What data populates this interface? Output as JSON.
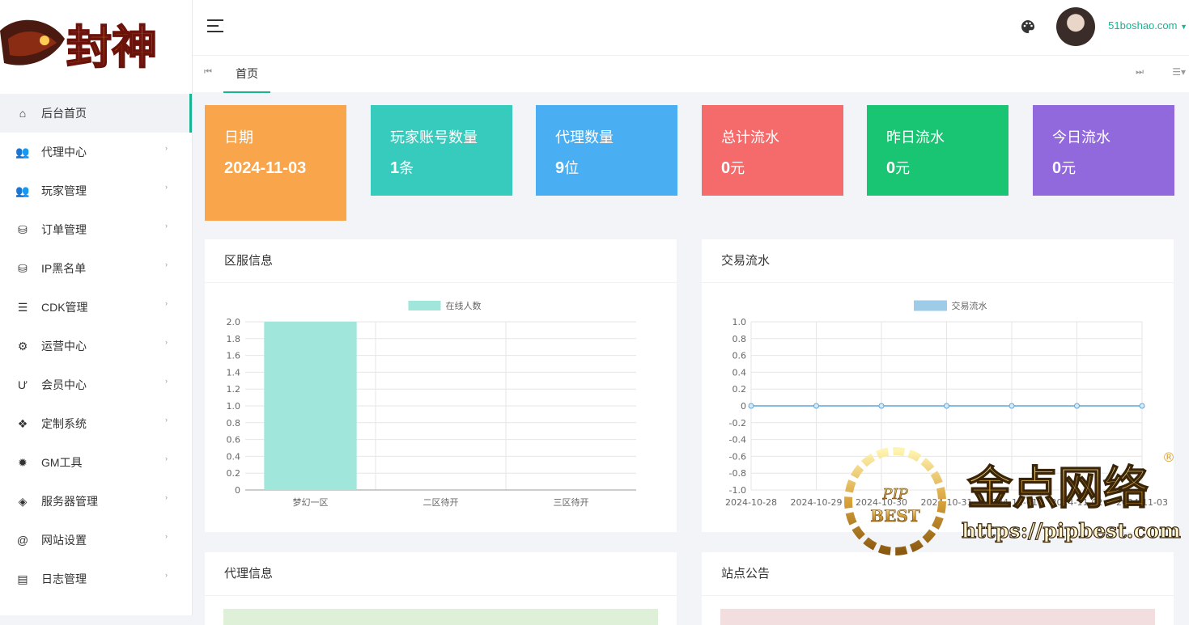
{
  "sidebar": {
    "logo_text": "封神",
    "items": [
      {
        "label": "后台首页",
        "icon": "home-icon",
        "active": true
      },
      {
        "label": "代理中心",
        "icon": "agents-icon"
      },
      {
        "label": "玩家管理",
        "icon": "users-icon"
      },
      {
        "label": "订单管理",
        "icon": "database-add-icon"
      },
      {
        "label": "IP黑名单",
        "icon": "database-block-icon"
      },
      {
        "label": "CDK管理",
        "icon": "list-icon"
      },
      {
        "label": "运营中心",
        "icon": "gear-icon"
      },
      {
        "label": "会员中心",
        "icon": "magnet-icon"
      },
      {
        "label": "定制系统",
        "icon": "diamond-grid-icon"
      },
      {
        "label": "GM工具",
        "icon": "bug-icon"
      },
      {
        "label": "服务器管理",
        "icon": "gem-icon"
      },
      {
        "label": "网站设置",
        "icon": "at-icon"
      },
      {
        "label": "日志管理",
        "icon": "comment-icon"
      }
    ]
  },
  "topbar": {
    "username": "51boshao.com"
  },
  "tabs": {
    "items": [
      {
        "label": "首页"
      }
    ]
  },
  "stat_cards": [
    {
      "label": "日期",
      "value": "2024-11-03",
      "unit": "",
      "color": "#f8a54b"
    },
    {
      "label": "玩家账号数量",
      "value": "1",
      "unit": "条",
      "color": "#36cbbc"
    },
    {
      "label": "代理数量",
      "value": "9",
      "unit": "位",
      "color": "#4aaef2"
    },
    {
      "label": "总计流水",
      "value": "0",
      "unit": "元",
      "color": "#f56a6a"
    },
    {
      "label": "昨日流水",
      "value": "0",
      "unit": "元",
      "color": "#19c473"
    },
    {
      "label": "今日流水",
      "value": "0",
      "unit": "元",
      "color": "#9268dd"
    }
  ],
  "panels": {
    "server_info": "区服信息",
    "trade_flow": "交易流水",
    "agent_info": "代理信息",
    "site_notice": "站点公告"
  },
  "chart_data": [
    {
      "type": "bar",
      "title": "",
      "categories": [
        "梦幻一区",
        "二区待开",
        "三区待开"
      ],
      "series": [
        {
          "name": "在线人数",
          "values": [
            2,
            0,
            0
          ],
          "color": "#a0e6db"
        }
      ],
      "ylim": [
        0,
        2.0
      ],
      "yticks": [
        "2.0",
        "1.8",
        "1.6",
        "1.4",
        "1.2",
        "1.0",
        "0.8",
        "0.6",
        "0.4",
        "0.2",
        "0"
      ],
      "grid": true,
      "legend": "top-center"
    },
    {
      "type": "line",
      "title": "",
      "categories": [
        "2024-10-28",
        "2024-10-29",
        "2024-10-30",
        "2024-10-31",
        "2024-11-01",
        "2024-11-02",
        "2024-11-03"
      ],
      "series": [
        {
          "name": "交易流水",
          "values": [
            0,
            0,
            0,
            0,
            0,
            0,
            0
          ],
          "color": "#9ecbe8"
        }
      ],
      "ylim": [
        -1.0,
        1.0
      ],
      "yticks": [
        "1.0",
        "0.8",
        "0.6",
        "0.4",
        "0.2",
        "0",
        "-0.2",
        "-0.4",
        "-0.6",
        "-0.8",
        "-1.0"
      ],
      "grid": true,
      "legend": "top-center"
    }
  ],
  "watermark": {
    "badge_top": "PIP",
    "badge_bottom": "BEST",
    "title": "金点网络",
    "url": "https://pipbest.com",
    "reg": "®"
  }
}
